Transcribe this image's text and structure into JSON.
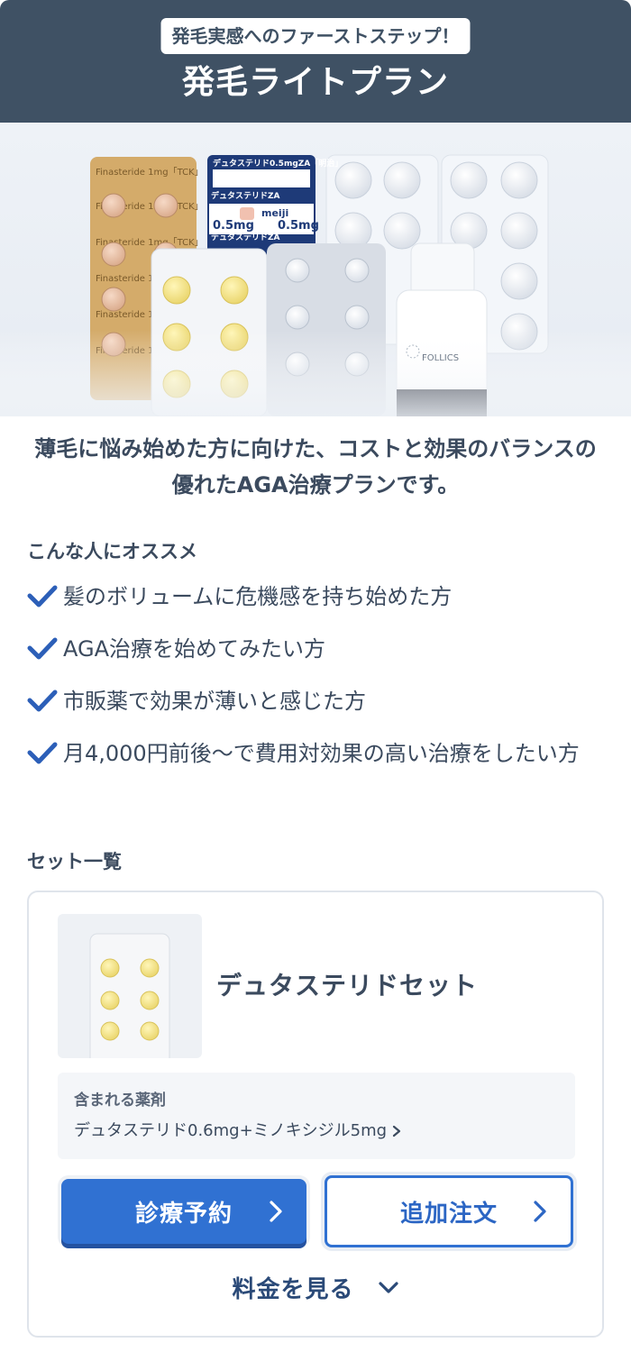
{
  "header": {
    "badge": "発毛実感へのファーストステップ！",
    "title": "発毛ライトプラン"
  },
  "hero": {
    "image": "hero-medicine-products",
    "package_labels": {
      "finasteride": "Finasteride 1mg「TCK」",
      "dutasteride": "デュタステリド0.5mgZA「明治」",
      "dutasteride_short": "デュタステリドZA",
      "dose": "0.5mg",
      "maker": "meiji",
      "bottle": "FOLLICS"
    }
  },
  "intro": "薄毛に悩み始めた方に向けた、コストと効果のバランスの優れたAGA治療プランです。",
  "recommend": {
    "label": "こんな人にオススメ",
    "items": [
      "髪のボリュームに危機感を持ち始めた方",
      "AGA治療を始めてみたい方",
      "市販薬で効果が薄いと感じた方",
      "月4,000円前後〜で費用対効果の高い治療をしたい方"
    ]
  },
  "sets": {
    "label": "セット一覧",
    "card": {
      "image": "dutasteride-blister-pack",
      "title": "デュタステリドセット",
      "medicine_label": "含まれる薬剤",
      "medicine_value": "デュタステリド0.6mg+ミノキシジル5mg",
      "reserve_button": "診療予約",
      "order_button": "追加注文",
      "price_link": "料金を見る"
    }
  },
  "colors": {
    "header_bg": "#3f5164",
    "accent": "#3071d2",
    "text": "#3b4a5e",
    "check": "#2c5fb8"
  }
}
